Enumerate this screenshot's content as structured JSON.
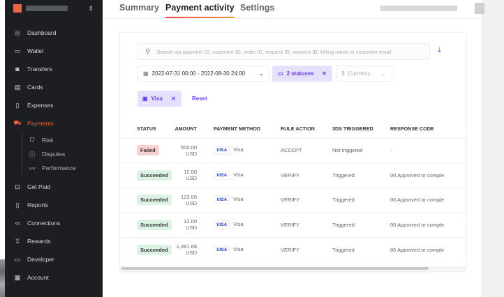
{
  "sidebar": {
    "items": [
      {
        "label": "Dashboard",
        "icon": "dashboard-icon"
      },
      {
        "label": "Wallet",
        "icon": "wallet-icon"
      },
      {
        "label": "Transfers",
        "icon": "transfers-icon"
      },
      {
        "label": "Cards",
        "icon": "cards-icon"
      },
      {
        "label": "Expenses",
        "icon": "expenses-icon"
      },
      {
        "label": "Payments",
        "icon": "cart-icon",
        "active": true
      },
      {
        "label": "Risk",
        "icon": "shield-icon"
      },
      {
        "label": "Disputes",
        "icon": "alert-icon"
      },
      {
        "label": "Performance",
        "icon": "chart-line-icon"
      },
      {
        "label": "Get Paid",
        "icon": "get-paid-icon"
      },
      {
        "label": "Reports",
        "icon": "document-icon"
      },
      {
        "label": "Connections",
        "icon": "link-icon"
      },
      {
        "label": "Rewards",
        "icon": "trophy-icon"
      },
      {
        "label": "Developer",
        "icon": "monitor-icon"
      },
      {
        "label": "Account",
        "icon": "store-icon"
      }
    ],
    "accent": "#f0643a"
  },
  "tabs": [
    {
      "label": "Summary"
    },
    {
      "label": "Payment activity",
      "active": true
    },
    {
      "label": "Settings"
    }
  ],
  "search": {
    "placeholder": "Search via payment ID, customer ID, order ID, request ID, consent ID, billing name or customer email"
  },
  "filters": {
    "date": "2022-07-31 00:00 - 2022-08-30 24:00",
    "status": "2 statuses",
    "currency": "Currency",
    "method": "Visa",
    "reset": "Reset"
  },
  "table": {
    "headers": [
      "STATUS",
      "AMOUNT",
      "PAYMENT METHOD",
      "RULE ACTION",
      "3DS TRIGGERED",
      "RESPONSE CODE"
    ],
    "rows": [
      {
        "status": "Failed",
        "amount": "500.00 USD",
        "logo": "VISA",
        "method": "Visa",
        "rule": "ACCEPT",
        "tds": "Not triggered",
        "code": "-"
      },
      {
        "status": "Succeeded",
        "amount": "12.00 USD",
        "logo": "VISA",
        "method": "Visa",
        "rule": "VERIFY",
        "tds": "Triggered",
        "code": "00 Approved or comple"
      },
      {
        "status": "Succeeded",
        "amount": "123.00 USD",
        "logo": "VISA",
        "method": "Visa",
        "rule": "VERIFY",
        "tds": "Triggered",
        "code": "00 Approved or comple"
      },
      {
        "status": "Succeeded",
        "amount": "12.00 USD",
        "logo": "VISA",
        "method": "Visa",
        "rule": "VERIFY",
        "tds": "Triggered",
        "code": "00 Approved or comple"
      },
      {
        "status": "Succeeded",
        "amount": "1,391.68 USD",
        "logo": "VISA",
        "method": "Visa",
        "rule": "VERIFY",
        "tds": "Triggered",
        "code": "00 Approved or comple"
      }
    ]
  }
}
